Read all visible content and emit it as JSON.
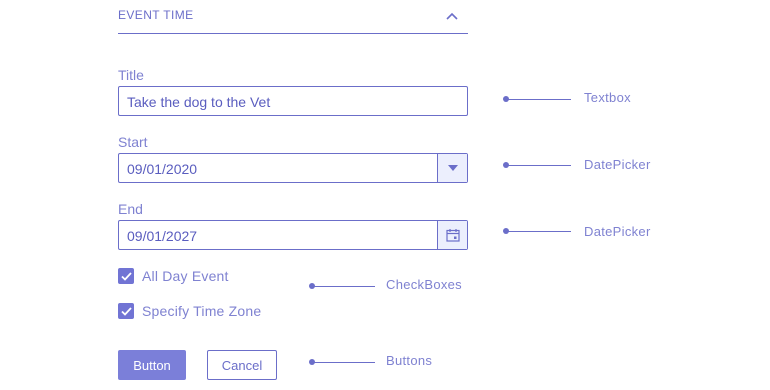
{
  "section": {
    "title": "EVENT TIME"
  },
  "fields": {
    "title_label": "Title",
    "title_value": "Take the dog to the Vet",
    "start_label": "Start",
    "start_value": "09/01/2020",
    "end_label": "End",
    "end_value": "09/01/2027"
  },
  "checkboxes": [
    {
      "label": "All Day Event",
      "checked": true
    },
    {
      "label": "Specify Time Zone",
      "checked": true
    }
  ],
  "buttons": {
    "primary": "Button",
    "secondary": "Cancel"
  },
  "annotations": {
    "textbox": "Textbox",
    "datepicker_start": "DatePicker",
    "datepicker_end": "DatePicker",
    "checkboxes": "CheckBoxes",
    "buttons": "Buttons"
  },
  "icons": {
    "section_toggle": "chevron-up-icon",
    "start_picker": "triangle-down-icon",
    "end_picker": "calendar-icon",
    "checkbox_mark": "checkmark-icon"
  },
  "colors": {
    "accent": "#6b6ec9",
    "primary_button": "#7b7fd9",
    "picker_button_bg": "#eceffd"
  }
}
